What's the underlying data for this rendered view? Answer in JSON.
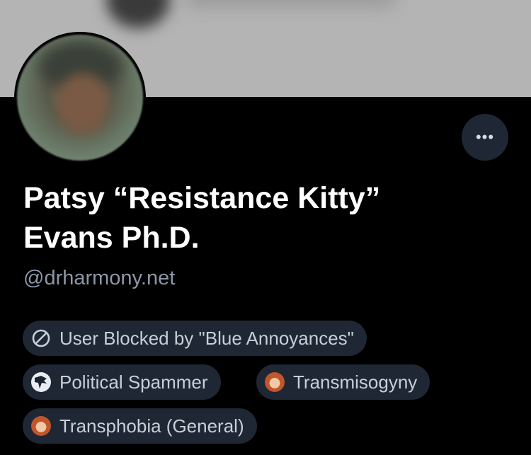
{
  "profile": {
    "name_line1": "Patsy “Resistance Kitty”",
    "name_line2": "Evans Ph.D.",
    "handle": "@drharmony.net",
    "more_label": "•••"
  },
  "labels": [
    {
      "text": "User Blocked by \"Blue Annoyances\"",
      "icon": "block-icon"
    },
    {
      "text": "Political Spammer",
      "icon": "eagle-badge-icon"
    },
    {
      "text": "Transmisogyny",
      "icon": "labeler-avatar-icon"
    },
    {
      "text": "Transphobia (General)",
      "icon": "labeler-avatar-icon"
    }
  ],
  "colors": {
    "background": "#000000",
    "banner": "#b4b4b4",
    "pill_bg": "#1e2733",
    "pill_text": "#c7cfd8",
    "handle_text": "#8b97a6"
  }
}
